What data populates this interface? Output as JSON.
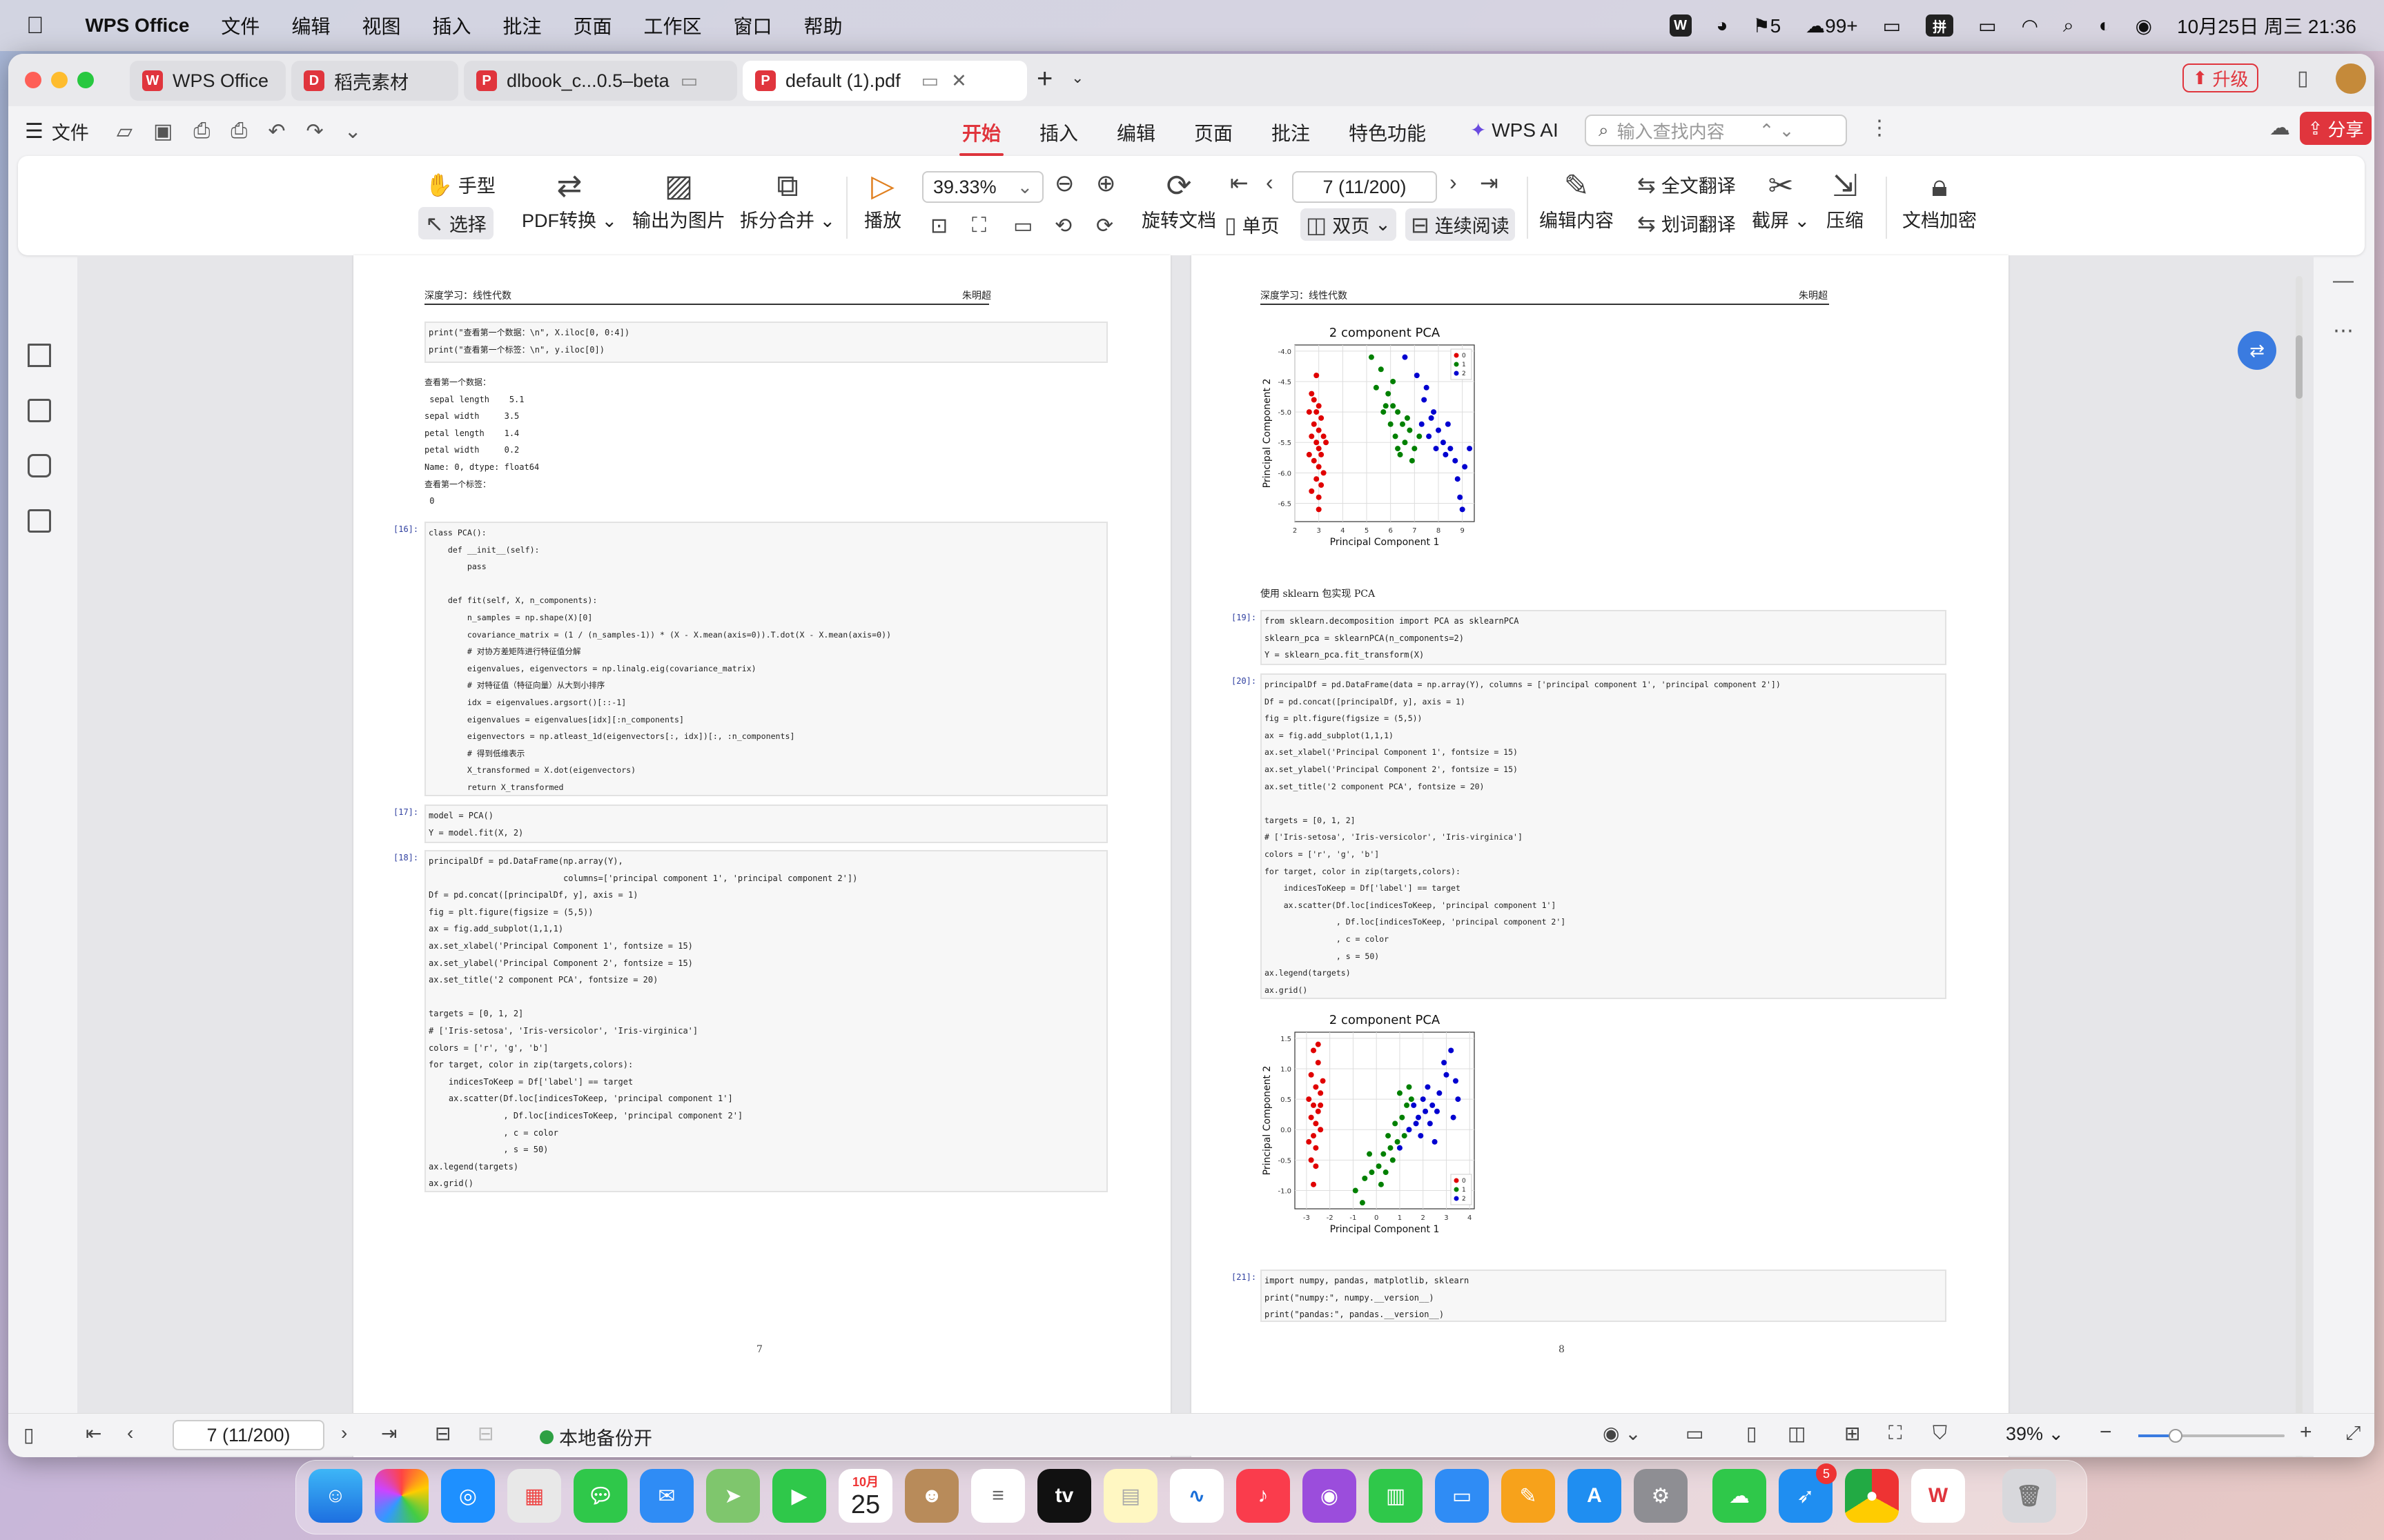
{
  "menubar": {
    "app_name": "WPS Office",
    "items": [
      "文件",
      "编辑",
      "视图",
      "插入",
      "批注",
      "页面",
      "工作区",
      "窗口",
      "帮助"
    ],
    "tray": {
      "badge1": "5",
      "wechat": "99+",
      "input": "拼",
      "datetime": "10月25日 周三  21:36"
    }
  },
  "tabs": [
    {
      "label": "WPS Office"
    },
    {
      "label": "稻壳素材"
    },
    {
      "label": "dlbook_c...0.5–beta"
    },
    {
      "label": "default (1).pdf"
    }
  ],
  "toolbar": {
    "file_label": "文件",
    "ribbon_tabs": [
      "开始",
      "插入",
      "编辑",
      "页面",
      "批注",
      "特色功能"
    ],
    "wps_ai": "WPS AI",
    "search_placeholder": "输入查找内容",
    "upgrade": "升级",
    "share": "分享"
  },
  "ribbon": {
    "hand": "手型",
    "select": "选择",
    "pdf_convert": "PDF转换",
    "export_image": "输出为图片",
    "split_merge": "拆分合并",
    "play": "播放",
    "zoom": "39.33%",
    "rotate": "旋转文档",
    "page_value": "7 (11/200)",
    "single": "单页",
    "double": "双页",
    "continuous": "连续阅读",
    "edit_content": "编辑内容",
    "full_translate": "全文翻译",
    "word_translate": "划词翻译",
    "screenshot": "截屏",
    "compress": "压缩",
    "encrypt": "文档加密"
  },
  "left_page": {
    "header_left": "深度学习：线性代数",
    "header_right": "朱明超",
    "cell_a": "print(\"查看第一个数据：\\n\", X.iloc[0, 0:4])\nprint(\"查看第一个标签：\\n\", y.iloc[0])",
    "output_a": "查看第一个数据：\n sepal length    5.1\nsepal width     3.5\npetal length    1.4\npetal width     0.2\nName: 0, dtype: float64\n查看第一个标签：\n 0",
    "prompt_16": "[16]:",
    "cell_16": "class PCA():\n    def __init__(self):\n        pass\n\n    def fit(self, X, n_components):\n        n_samples = np.shape(X)[0]\n        covariance_matrix = (1 / (n_samples-1)) * (X - X.mean(axis=0)).T.dot(X - X.mean(axis=0))\n        # 对协方差矩阵进行特征值分解\n        eigenvalues, eigenvectors = np.linalg.eig(covariance_matrix)\n        # 对特征值（特征向量）从大到小排序\n        idx = eigenvalues.argsort()[::-1]\n        eigenvalues = eigenvalues[idx][:n_components]\n        eigenvectors = np.atleast_1d(eigenvectors[:, idx])[:, :n_components]\n        # 得到低维表示\n        X_transformed = X.dot(eigenvectors)\n        return X_transformed",
    "prompt_17": "[17]:",
    "cell_17": "model = PCA()\nY = model.fit(X, 2)",
    "prompt_18": "[18]:",
    "cell_18": "principalDf = pd.DataFrame(np.array(Y),\n                           columns=['principal component 1', 'principal component 2'])\nDf = pd.concat([principalDf, y], axis = 1)\nfig = plt.figure(figsize = (5,5))\nax = fig.add_subplot(1,1,1)\nax.set_xlabel('Principal Component 1', fontsize = 15)\nax.set_ylabel('Principal Component 2', fontsize = 15)\nax.set_title('2 component PCA', fontsize = 20)\n\ntargets = [0, 1, 2]\n# ['Iris-setosa', 'Iris-versicolor', 'Iris-virginica']\ncolors = ['r', 'g', 'b']\nfor target, color in zip(targets,colors):\n    indicesToKeep = Df['label'] == target\n    ax.scatter(Df.loc[indicesToKeep, 'principal component 1']\n               , Df.loc[indicesToKeep, 'principal component 2']\n               , c = color\n               , s = 50)\nax.legend(targets)\nax.grid()",
    "page_number": "7"
  },
  "right_page": {
    "header_left": "深度学习：线性代数",
    "header_right": "朱明超",
    "sklearn_text": "使用 sklearn 包实现 PCA",
    "prompt_19": "[19]:",
    "cell_19": "from sklearn.decomposition import PCA as sklearnPCA\nsklearn_pca = sklearnPCA(n_components=2)\nY = sklearn_pca.fit_transform(X)",
    "prompt_20": "[20]:",
    "cell_20": "principalDf = pd.DataFrame(data = np.array(Y), columns = ['principal component 1', 'principal component 2'])\nDf = pd.concat([principalDf, y], axis = 1)\nfig = plt.figure(figsize = (5,5))\nax = fig.add_subplot(1,1,1)\nax.set_xlabel('Principal Component 1', fontsize = 15)\nax.set_ylabel('Principal Component 2', fontsize = 15)\nax.set_title('2 component PCA', fontsize = 20)\n\ntargets = [0, 1, 2]\n# ['Iris-setosa', 'Iris-versicolor', 'Iris-virginica']\ncolors = ['r', 'g', 'b']\nfor target, color in zip(targets,colors):\n    indicesToKeep = Df['label'] == target\n    ax.scatter(Df.loc[indicesToKeep, 'principal component 1']\n               , Df.loc[indicesToKeep, 'principal component 2']\n               , c = color\n               , s = 50)\nax.legend(targets)\nax.grid()",
    "prompt_21": "[21]:",
    "cell_21": "import numpy, pandas, matplotlib, sklearn\nprint(\"numpy:\", numpy.__version__)\nprint(\"pandas:\", pandas.__version__)",
    "page_number": "8"
  },
  "status": {
    "page": "7 (11/200)",
    "backup": "本地备份开",
    "zoom": "39%"
  },
  "dock": {
    "calendar_month": "10月",
    "calendar_day": "25",
    "badge": "5"
  },
  "chart_data": [
    {
      "type": "scatter",
      "title": "2 component PCA",
      "xlabel": "Principal Component 1",
      "ylabel": "Principal Component 2",
      "xlim": [
        2,
        9.5
      ],
      "ylim": [
        -6.8,
        -3.9
      ],
      "xticks": [
        2,
        3,
        4,
        5,
        6,
        7,
        8,
        9
      ],
      "yticks": [
        -4.0,
        -4.5,
        -5.0,
        -5.5,
        -6.0,
        -6.5
      ],
      "grid": true,
      "legend_position": "top-right",
      "series": [
        {
          "name": "0",
          "color": "#e00000",
          "points": [
            [
              2.7,
              -4.7
            ],
            [
              2.8,
              -4.8
            ],
            [
              3.0,
              -4.9
            ],
            [
              2.6,
              -5.0
            ],
            [
              2.9,
              -5.0
            ],
            [
              3.1,
              -5.1
            ],
            [
              2.8,
              -5.2
            ],
            [
              3.0,
              -5.3
            ],
            [
              2.7,
              -5.4
            ],
            [
              3.2,
              -5.4
            ],
            [
              2.9,
              -5.5
            ],
            [
              3.0,
              -5.6
            ],
            [
              2.6,
              -5.7
            ],
            [
              3.1,
              -5.7
            ],
            [
              2.8,
              -5.8
            ],
            [
              3.0,
              -5.9
            ],
            [
              3.2,
              -6.0
            ],
            [
              2.9,
              -6.1
            ],
            [
              3.1,
              -6.2
            ],
            [
              2.7,
              -6.3
            ],
            [
              3.0,
              -6.4
            ],
            [
              3.3,
              -5.5
            ],
            [
              2.9,
              -4.4
            ],
            [
              3.0,
              -6.6
            ]
          ]
        },
        {
          "name": "1",
          "color": "#008000",
          "points": [
            [
              5.2,
              -4.1
            ],
            [
              5.6,
              -4.3
            ],
            [
              5.4,
              -4.6
            ],
            [
              5.9,
              -4.7
            ],
            [
              6.1,
              -4.9
            ],
            [
              5.7,
              -5.0
            ],
            [
              6.3,
              -5.0
            ],
            [
              6.0,
              -5.2
            ],
            [
              6.5,
              -5.2
            ],
            [
              6.2,
              -5.4
            ],
            [
              6.8,
              -5.3
            ],
            [
              6.6,
              -5.5
            ],
            [
              7.0,
              -5.6
            ],
            [
              6.4,
              -5.7
            ],
            [
              6.9,
              -5.8
            ],
            [
              6.1,
              -4.5
            ],
            [
              5.8,
              -4.9
            ],
            [
              6.7,
              -5.1
            ],
            [
              7.2,
              -5.4
            ],
            [
              6.3,
              -5.6
            ]
          ]
        },
        {
          "name": "2",
          "color": "#0000d0",
          "points": [
            [
              6.6,
              -4.1
            ],
            [
              7.1,
              -4.4
            ],
            [
              7.4,
              -4.8
            ],
            [
              7.8,
              -5.0
            ],
            [
              7.3,
              -5.2
            ],
            [
              8.0,
              -5.3
            ],
            [
              7.6,
              -5.4
            ],
            [
              8.2,
              -5.5
            ],
            [
              7.9,
              -5.6
            ],
            [
              8.5,
              -5.6
            ],
            [
              8.7,
              -5.8
            ],
            [
              9.1,
              -5.9
            ],
            [
              8.3,
              -5.7
            ],
            [
              8.8,
              -6.1
            ],
            [
              9.3,
              -5.6
            ],
            [
              9.0,
              -6.6
            ],
            [
              8.9,
              -6.4
            ],
            [
              7.7,
              -5.1
            ],
            [
              8.4,
              -5.2
            ],
            [
              7.5,
              -4.6
            ]
          ]
        }
      ]
    },
    {
      "type": "scatter",
      "title": "2 component PCA",
      "xlabel": "Principal Component 1",
      "ylabel": "Principal Component 2",
      "xlim": [
        -3.5,
        4.2
      ],
      "ylim": [
        -1.3,
        1.6
      ],
      "xticks": [
        -3,
        -2,
        -1,
        0,
        1,
        2,
        3,
        4
      ],
      "yticks": [
        1.5,
        1.0,
        0.5,
        0.0,
        -0.5,
        -1.0
      ],
      "grid": true,
      "legend_position": "bottom-right",
      "series": [
        {
          "name": "0",
          "color": "#e00000",
          "points": [
            [
              -2.7,
              1.3
            ],
            [
              -2.5,
              1.1
            ],
            [
              -2.8,
              0.9
            ],
            [
              -2.6,
              0.7
            ],
            [
              -2.4,
              0.6
            ],
            [
              -2.9,
              0.5
            ],
            [
              -2.7,
              0.4
            ],
            [
              -2.5,
              0.3
            ],
            [
              -2.8,
              0.2
            ],
            [
              -2.6,
              0.1
            ],
            [
              -2.4,
              0.0
            ],
            [
              -2.7,
              -0.1
            ],
            [
              -2.9,
              -0.2
            ],
            [
              -2.6,
              -0.3
            ],
            [
              -2.8,
              -0.5
            ],
            [
              -2.5,
              1.4
            ],
            [
              -2.3,
              0.8
            ],
            [
              -2.7,
              -0.9
            ],
            [
              -2.6,
              -0.6
            ],
            [
              -2.4,
              0.4
            ]
          ]
        },
        {
          "name": "1",
          "color": "#008000",
          "points": [
            [
              -0.9,
              -1.0
            ],
            [
              -0.5,
              -0.8
            ],
            [
              -0.2,
              -0.7
            ],
            [
              0.1,
              -0.6
            ],
            [
              0.3,
              -0.4
            ],
            [
              0.6,
              -0.3
            ],
            [
              0.9,
              -0.2
            ],
            [
              0.5,
              -0.1
            ],
            [
              0.8,
              0.1
            ],
            [
              1.1,
              0.2
            ],
            [
              1.3,
              0.4
            ],
            [
              1.0,
              0.6
            ],
            [
              1.5,
              0.5
            ],
            [
              0.2,
              -0.9
            ],
            [
              -0.6,
              -1.2
            ],
            [
              0.7,
              -0.5
            ],
            [
              1.2,
              -0.1
            ],
            [
              0.4,
              -0.7
            ],
            [
              -0.3,
              -0.4
            ],
            [
              1.4,
              0.7
            ]
          ]
        },
        {
          "name": "2",
          "color": "#0000d0",
          "points": [
            [
              1.0,
              -0.3
            ],
            [
              1.4,
              0.0
            ],
            [
              1.8,
              0.2
            ],
            [
              2.1,
              0.3
            ],
            [
              2.4,
              0.4
            ],
            [
              2.0,
              0.5
            ],
            [
              2.7,
              0.6
            ],
            [
              3.0,
              0.9
            ],
            [
              2.3,
              0.1
            ],
            [
              2.9,
              1.1
            ],
            [
              3.2,
              1.3
            ],
            [
              3.4,
              0.8
            ],
            [
              2.6,
              0.3
            ],
            [
              1.9,
              -0.1
            ],
            [
              1.6,
              0.4
            ],
            [
              2.5,
              -0.2
            ],
            [
              3.3,
              0.2
            ],
            [
              2.2,
              0.7
            ],
            [
              1.7,
              0.1
            ],
            [
              3.5,
              0.5
            ]
          ]
        }
      ]
    }
  ]
}
